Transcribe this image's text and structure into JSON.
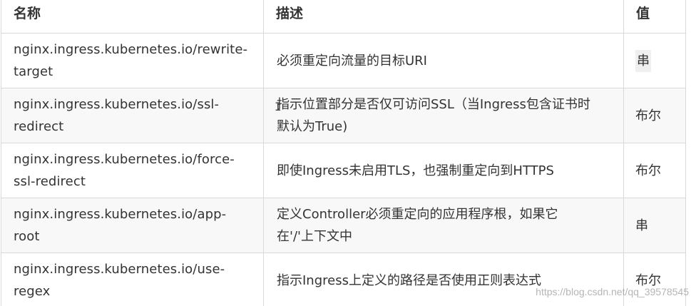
{
  "table": {
    "headers": [
      "名称",
      "描述",
      "值"
    ],
    "rows": [
      {
        "name_line1": "nginx.ingress.kubernetes.io/rewrite-",
        "name_line2": "target",
        "desc_line1": "必须重定向流量的目标URI",
        "desc_line2": "",
        "value": "串"
      },
      {
        "name_line1": "nginx.ingress.kubernetes.io/ssl-",
        "name_line2": "redirect",
        "desc_line1": "指示位置部分是否仅可访问SSL（当Ingress包含证书时",
        "desc_line2": "默认为True)",
        "value": "布尔"
      },
      {
        "name_line1": "nginx.ingress.kubernetes.io/force-",
        "name_line2": "ssl-redirect",
        "desc_line1": "即使Ingress未启用TLS，也强制重定向到HTTPS",
        "desc_line2": "",
        "value": "布尔"
      },
      {
        "name_line1": "nginx.ingress.kubernetes.io/app-",
        "name_line2": "root",
        "desc_line1": "定义Controller必须重定向的应用程序根，如果它",
        "desc_line2": "在'/'上下文中",
        "value": "串"
      },
      {
        "name_line1": "nginx.ingress.kubernetes.io/use-",
        "name_line2": "regex",
        "desc_line1": "指示Ingress上定义的路径是否使用正则表达式",
        "desc_line2": "",
        "value": "布尔"
      }
    ]
  },
  "watermark": "https://blog.csdn.net/qq_39578545",
  "cursor_glyph": "I",
  "colors": {
    "border": "#d9d9d9",
    "text": "#333333",
    "alt_row": "#f8f8f8",
    "highlight": "#efefef"
  }
}
